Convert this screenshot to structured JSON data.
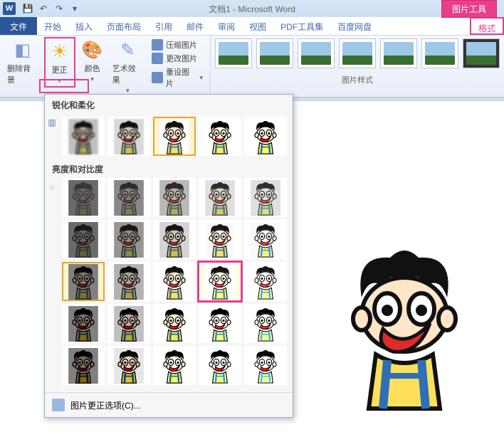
{
  "titlebar": {
    "doc_title": "文档1 - Microsoft Word",
    "context_tab": "图片工具",
    "qat": {
      "save": "💾",
      "undo": "↶",
      "redo": "↷",
      "more": "▾"
    }
  },
  "tabs": {
    "file": "文件",
    "items": [
      "开始",
      "插入",
      "页面布局",
      "引用",
      "邮件",
      "审阅",
      "视图",
      "PDF工具集",
      "百度网盘"
    ],
    "format": "格式"
  },
  "ribbon": {
    "remove_bg": "删除背景",
    "corrections": "更正",
    "color": "颜色",
    "artistic": "艺术效果",
    "compress": "压缩图片",
    "change_pic": "更改图片",
    "reset_pic": "重设图片",
    "styles_label": "图片样式"
  },
  "popup": {
    "sharpen_label": "锐化和柔化",
    "brightness_label": "亮度和对比度",
    "footer": "图片更正选项(C)...",
    "sharpen_presets": [
      {
        "id": "sh-1",
        "filter": "blur(1.2px) brightness(.75)"
      },
      {
        "id": "sh-2",
        "filter": "blur(.6px) brightness(.85)"
      },
      {
        "id": "sh-3",
        "filter": "none",
        "selected": true
      },
      {
        "id": "sh-4",
        "filter": "contrast(1.15)"
      },
      {
        "id": "sh-5",
        "filter": "contrast(1.35)"
      }
    ],
    "brightness_grid": {
      "rows": 5,
      "cols": 5,
      "selected": [
        2,
        0
      ],
      "highlighted": [
        2,
        3
      ],
      "filters": [
        [
          "brightness(.35) contrast(.6)",
          "brightness(.55) contrast(.7)",
          "brightness(.8) contrast(.75)",
          "brightness(1) contrast(.75)",
          "brightness(1.25) contrast(.75)"
        ],
        [
          "brightness(.4) contrast(.85)",
          "brightness(.6) contrast(.9)",
          "brightness(.85) contrast(.95)",
          "brightness(1.05) contrast(.95)",
          "brightness(1.3) contrast(.95)"
        ],
        [
          "brightness(.5)",
          "brightness(.7)",
          "none",
          "brightness(1.2)",
          "brightness(1.45)"
        ],
        [
          "brightness(.5) contrast(1.25)",
          "brightness(.7) contrast(1.25)",
          "brightness(.95) contrast(1.25)",
          "brightness(1.2) contrast(1.25)",
          "brightness(1.45) contrast(1.25)"
        ],
        [
          "brightness(.5) contrast(1.6)",
          "brightness(.75) contrast(1.6)",
          "brightness(1) contrast(1.6)",
          "brightness(1.25) contrast(1.6)",
          "brightness(1.5) contrast(1.6)"
        ]
      ]
    }
  },
  "icons": {
    "sun": "☀",
    "eraser": "◧",
    "palette": "🎨",
    "brush": "✎"
  }
}
